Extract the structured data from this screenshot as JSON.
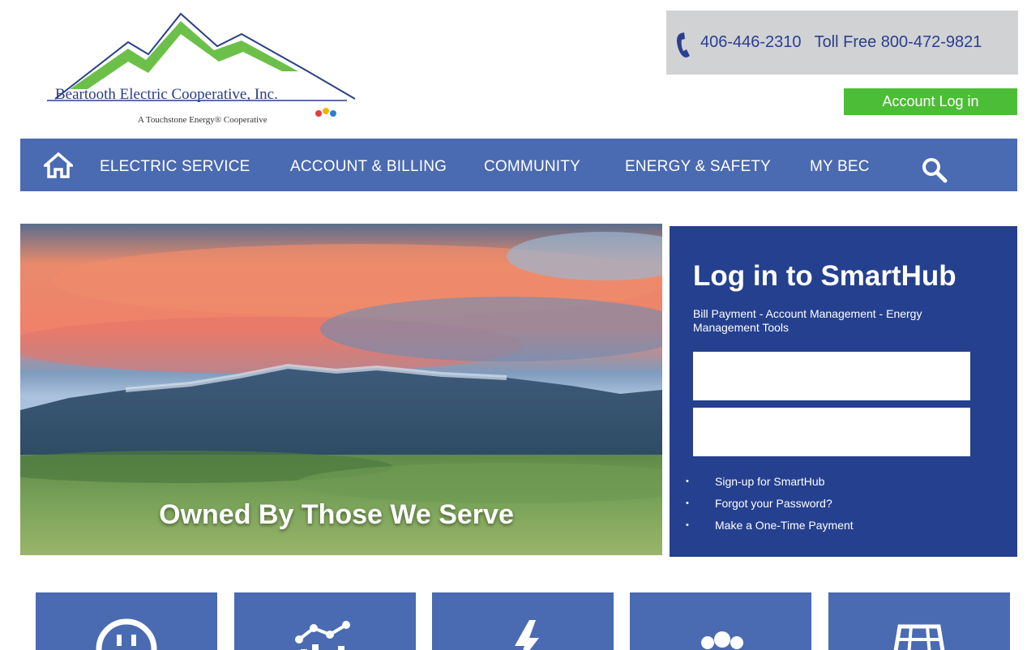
{
  "header": {
    "logo_title": "Beartooth Electric Cooperative, Inc.",
    "logo_tagline": "A Touchstone Energy® Cooperative",
    "phone": "406-446-2310",
    "toll_free": "Toll Free 800-472-9821",
    "account_login": "Account Log in"
  },
  "nav": {
    "items": [
      {
        "label": "ELECTRIC SERVICE"
      },
      {
        "label": "ACCOUNT & BILLING"
      },
      {
        "label": "COMMUNITY"
      },
      {
        "label": "ENERGY & SAFETY"
      },
      {
        "label": "MY BEC"
      }
    ]
  },
  "hero": {
    "caption": "Owned By Those We Serve"
  },
  "smarthub": {
    "title": "Log in to SmartHub",
    "subtitle": "Bill Payment - Account Management - Energy Management Tools",
    "username_value": "",
    "password_value": "",
    "links": [
      {
        "label": "Sign-up for SmartHub"
      },
      {
        "label": "Forgot your Password?"
      },
      {
        "label": "Make a One-Time Payment"
      }
    ]
  },
  "tiles": [
    {
      "icon": "outlet-icon"
    },
    {
      "icon": "usage-chart-icon"
    },
    {
      "icon": "lightning-icon"
    },
    {
      "icon": "community-icon"
    },
    {
      "icon": "solar-panel-icon"
    }
  ],
  "colors": {
    "nav_blue": "#4a6ab2",
    "panel_blue": "#25408f",
    "login_green": "#4cbd36",
    "phone_gray": "#d1d2d4"
  }
}
